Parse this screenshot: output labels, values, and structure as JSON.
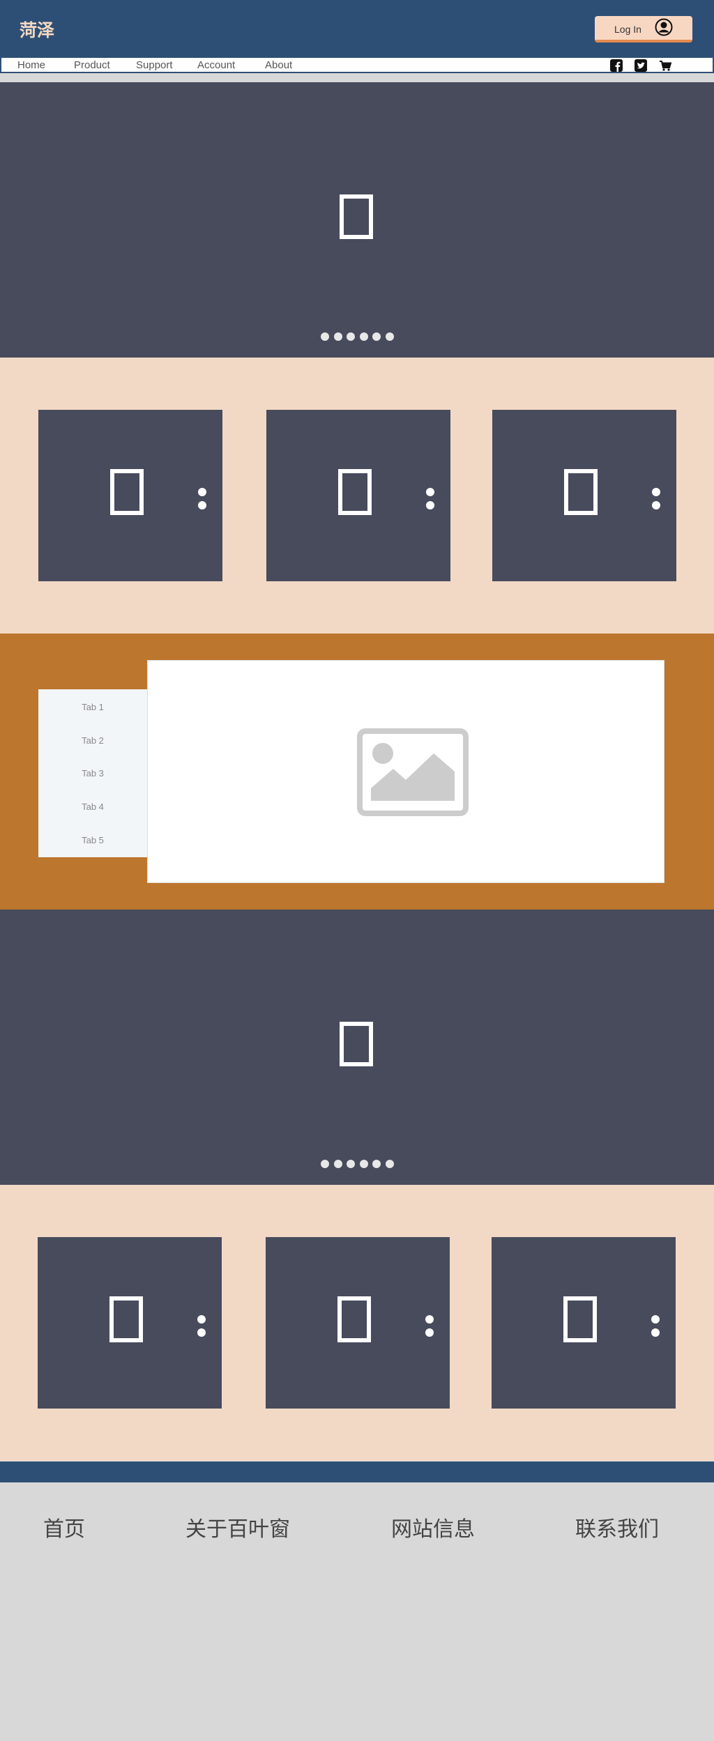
{
  "header": {
    "brand": "菏泽",
    "login_label": "Log In",
    "icons": [
      "user-avatar-icon",
      "facebook-icon",
      "twitter-icon",
      "cart-icon"
    ]
  },
  "nav": {
    "items": [
      "Home",
      "Product",
      "Support",
      "Account",
      "About"
    ]
  },
  "tabs": {
    "items": [
      "Tab 1",
      "Tab 2",
      "Tab 3",
      "Tab 4",
      "Tab 5"
    ],
    "panel_icon": "image-placeholder-icon"
  },
  "footer": {
    "links": [
      "首页",
      "关于百叶窗",
      "网站信息",
      "联系我们"
    ]
  },
  "colors": {
    "header": "#2e4f75",
    "banner": "#474b5c",
    "cards_bg": "#f2d9c5",
    "tabs_bg": "#bc762d",
    "accent": "#e48a4f",
    "footer_bg": "#d8d8d8"
  }
}
